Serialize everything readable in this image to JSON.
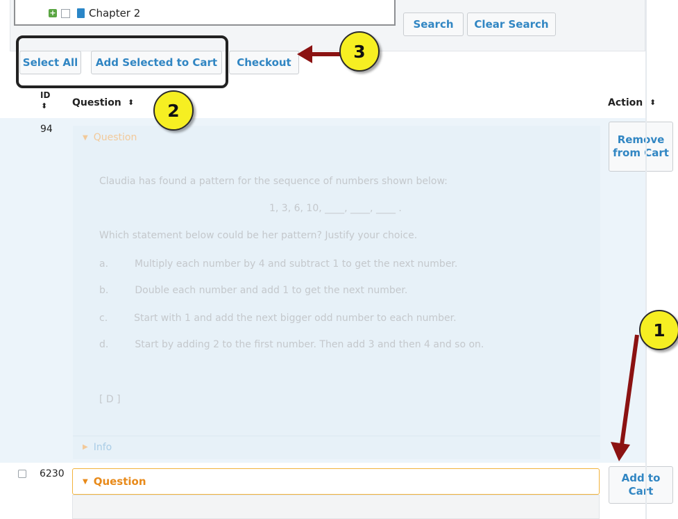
{
  "tree": {
    "chapter_label": "Chapter 2"
  },
  "filters": {
    "search_label": "Search",
    "clear_label": "Clear Search"
  },
  "toolbar": {
    "select_all_label": "Select All",
    "add_selected_label": "Add Selected to Cart",
    "checkout_label": "Checkout"
  },
  "table": {
    "col_id": "ID",
    "col_question": "Question",
    "col_action": "Action"
  },
  "rows": [
    {
      "id": "94",
      "section_title": "Question",
      "question_text": "Claudia has found a pattern for the sequence of numbers shown below:",
      "sequence": "1, 3, 6, 10, ____, ____, ____ .",
      "prompt": "Which statement below could be her pattern? Justify your choice.",
      "options": [
        {
          "letter": "a.",
          "text": "Multiply each number by 4 and subtract 1 to get the next number."
        },
        {
          "letter": "b.",
          "text": "Double each number and add 1 to get the next number."
        },
        {
          "letter": "c.",
          "text": "Start with 1 and add the next bigger odd number to each number."
        },
        {
          "letter": "d.",
          "text": "Start by adding 2 to the first number. Then add 3 and then 4 and so on."
        }
      ],
      "answer": "[ D ]",
      "info_title": "Info",
      "action_label": "Remove from Cart"
    },
    {
      "id": "6230",
      "section_title": "Question",
      "action_label": "Add to Cart"
    }
  ],
  "callouts": {
    "one": "1",
    "two": "2",
    "three": "3"
  },
  "colors": {
    "link_blue": "#3186c3",
    "callout_yellow": "#f6ef22",
    "arrow_red": "#8b1212",
    "orange": "#e88a1a"
  }
}
